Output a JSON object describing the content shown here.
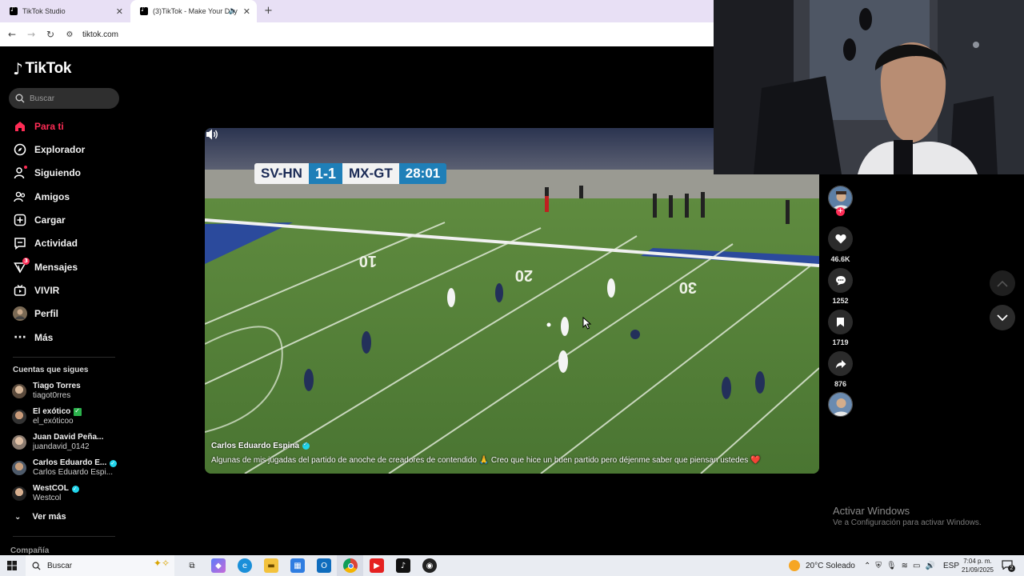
{
  "browser": {
    "tabs": [
      {
        "title": "TikTok Studio",
        "active": false
      },
      {
        "title": "(3)TikTok - Make Your Day",
        "active": true
      }
    ],
    "new_tab": "+",
    "url": "tiktok.com"
  },
  "sidebar": {
    "logo": "TikTok",
    "search_placeholder": "Buscar",
    "nav": [
      {
        "label": "Para ti",
        "icon": "home-icon",
        "active": true
      },
      {
        "label": "Explorador",
        "icon": "compass-icon"
      },
      {
        "label": "Siguiendo",
        "icon": "following-icon"
      },
      {
        "label": "Amigos",
        "icon": "friends-icon"
      },
      {
        "label": "Cargar",
        "icon": "upload-icon"
      },
      {
        "label": "Actividad",
        "icon": "activity-icon"
      },
      {
        "label": "Mensajes",
        "icon": "messages-icon",
        "badge": "3"
      },
      {
        "label": "VIVIR",
        "icon": "live-icon"
      },
      {
        "label": "Perfil",
        "icon": "avatar-icon"
      },
      {
        "label": "Más",
        "icon": "more-icon"
      }
    ],
    "following_heading": "Cuentas que sigues",
    "following": [
      {
        "name": "Tiago Torres",
        "handle": "tiagot0rres"
      },
      {
        "name": "El exótico",
        "handle": "el_exóticoo"
      },
      {
        "name": "Juan David Peña...",
        "handle": "juandavid_0142"
      },
      {
        "name": "Carlos Eduardo E...",
        "handle": "Carlos Eduardo Espi..."
      },
      {
        "name": "WestCOL",
        "handle": "Westcol"
      }
    ],
    "see_more": "Ver más",
    "company": "Compañía"
  },
  "video": {
    "scoreboard": {
      "home": "SV-HN",
      "score": "1-1",
      "away": "MX-GT",
      "time": "28:01"
    },
    "field_numbers": [
      "10",
      "20",
      "30"
    ],
    "author": "Carlos Eduardo Espina",
    "caption": "Algunas de mis jugadas del partido de anoche de creadores de contendido 🙏 Creo que hice un buen partido pero déjenme saber que piensan ustedes ❤️"
  },
  "actions": {
    "likes": "46.6K",
    "comments": "1252",
    "saves": "1719",
    "shares": "876"
  },
  "watermark": {
    "title": "Activar Windows",
    "subtitle": "Ve a Configuración para activar Windows."
  },
  "taskbar": {
    "search": "Buscar",
    "weather": "20°C  Soleado",
    "lang": "ESP",
    "time": "7:04 p. m.",
    "date": "21/09/2025",
    "notifications": "2"
  },
  "colors": {
    "accent": "#fe2c55",
    "pitch": "#4e7a36",
    "scoreboard_blue": "#1f7fb8",
    "verified": "#20d5ec"
  }
}
